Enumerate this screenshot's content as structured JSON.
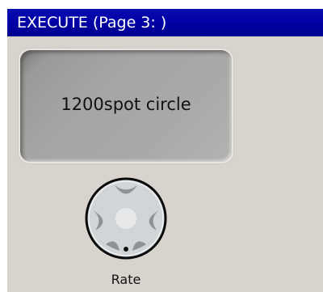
{
  "window": {
    "title": "EXECUTE (Page 3: )"
  },
  "executor": {
    "button_label": "1200spot circle"
  },
  "rate": {
    "label": "Rate",
    "icon": "rotary-knob-icon"
  },
  "colors": {
    "titlebar": "#0000a6",
    "panel_background": "#d8d4cd",
    "button_face": "#a6a5a3",
    "knob_face": "#cfd2d4"
  }
}
